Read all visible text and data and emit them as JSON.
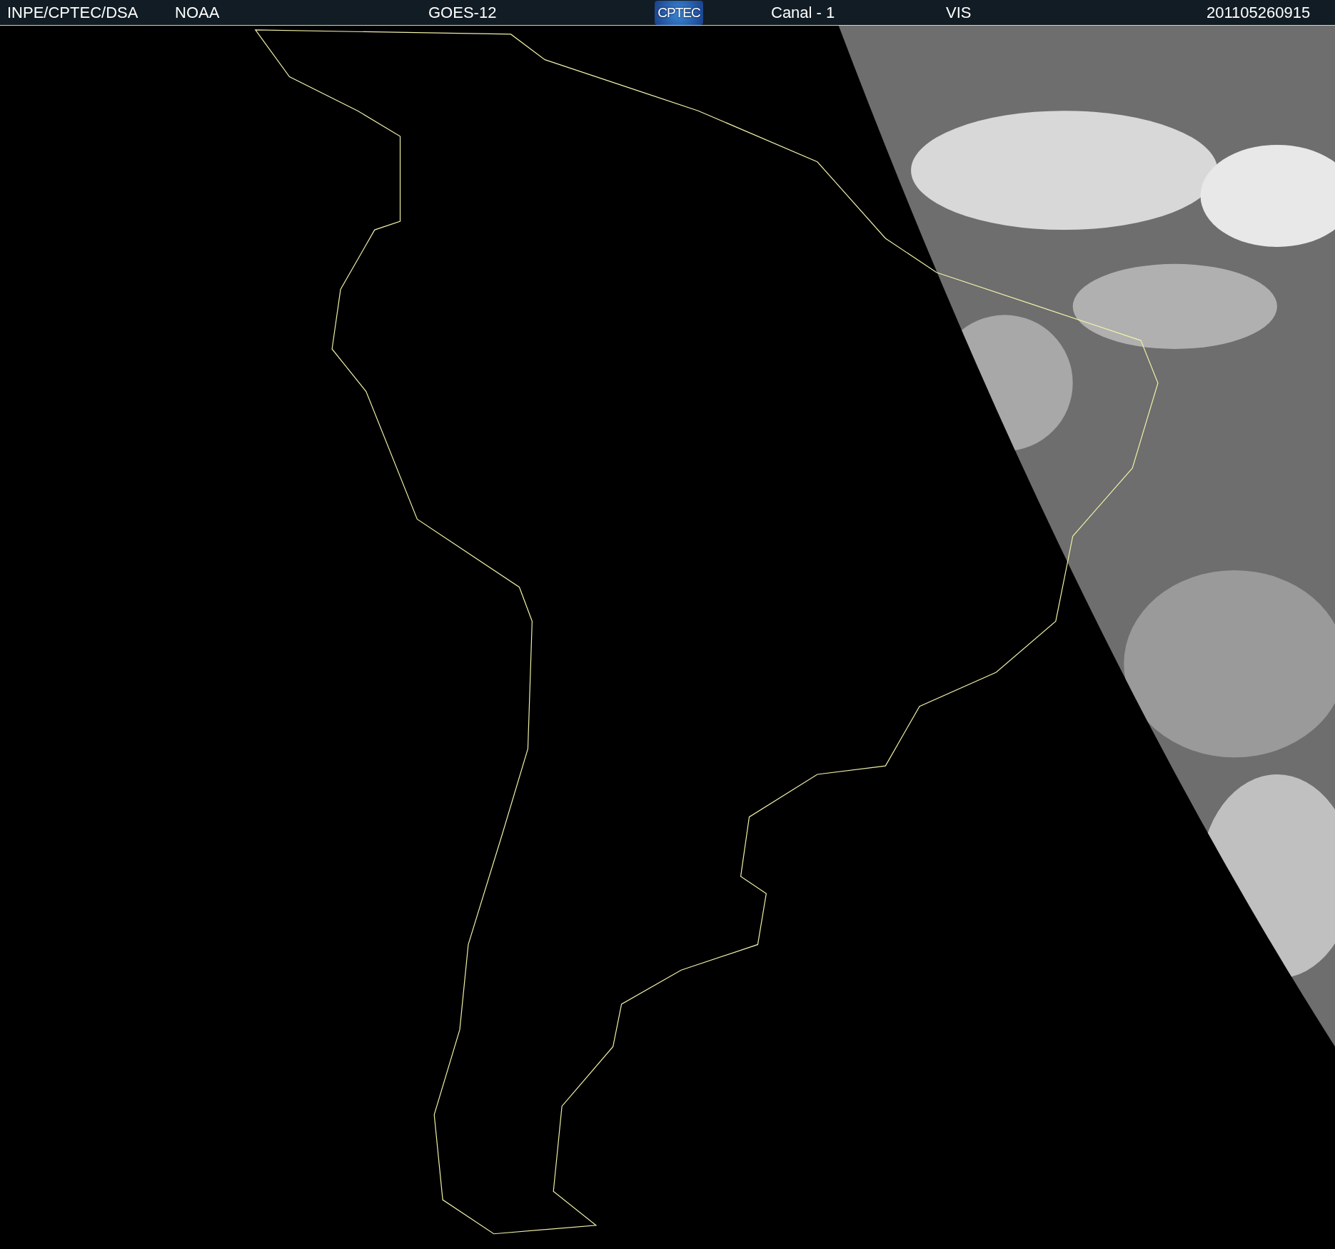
{
  "header": {
    "items": [
      {
        "kind": "text",
        "label": "INPE/CPTEC/DSA"
      },
      {
        "kind": "text",
        "label": "NOAA"
      },
      {
        "kind": "text",
        "label": "GOES-12"
      },
      {
        "kind": "logo",
        "label": "CPTEC"
      },
      {
        "kind": "text",
        "label": "Canal - 1"
      },
      {
        "kind": "text",
        "label": "VIS"
      },
      {
        "kind": "text",
        "label": "201105260915"
      }
    ]
  }
}
